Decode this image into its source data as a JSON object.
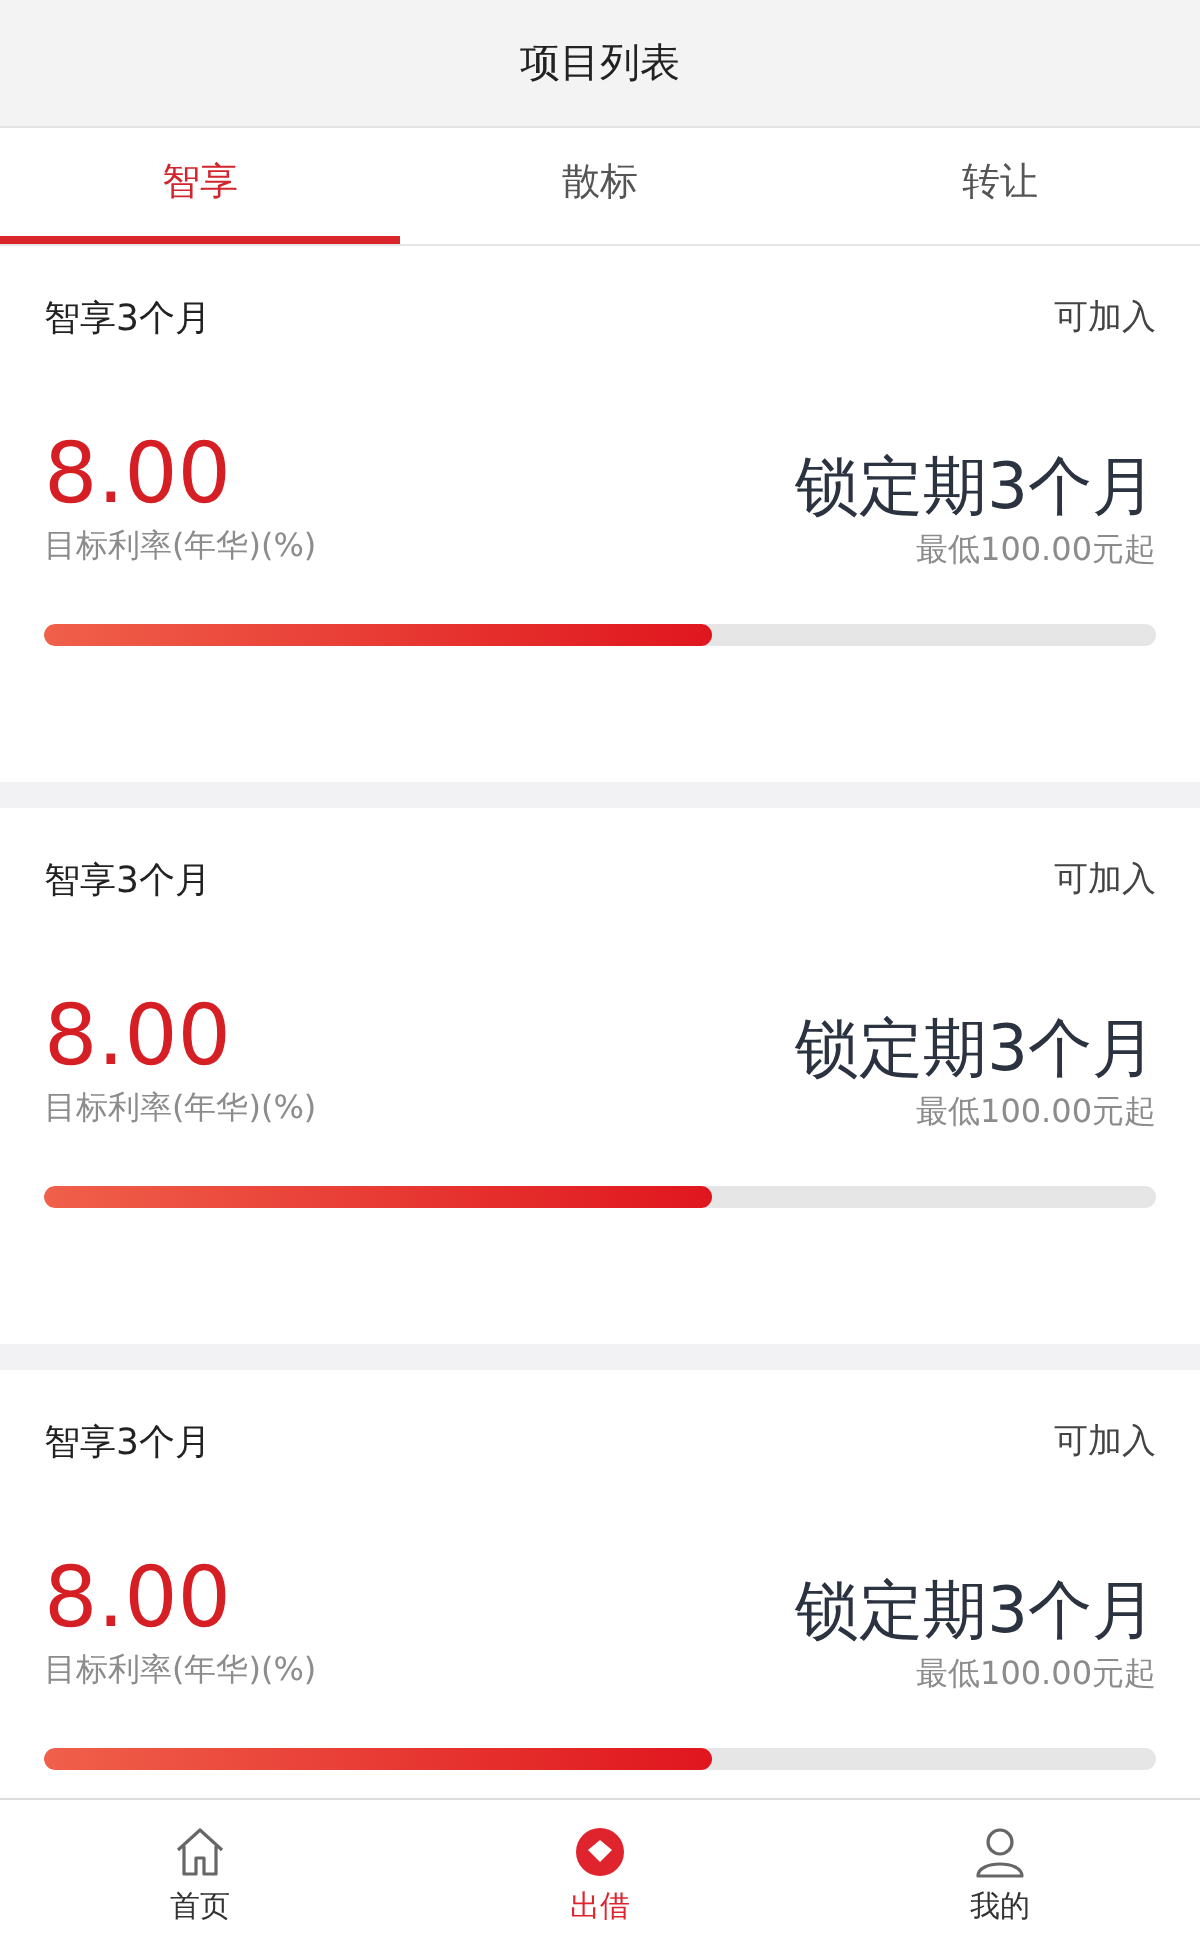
{
  "header": {
    "title": "项目列表"
  },
  "tabs": [
    {
      "label": "智享",
      "selected": true
    },
    {
      "label": "散标",
      "selected": false
    },
    {
      "label": "转让",
      "selected": false
    }
  ],
  "products": [
    {
      "name": "智享3个月",
      "status": "可加入",
      "rate": "8.00",
      "rate_label": "目标利率(年华)(%)",
      "term": "锁定期3个月",
      "minimum": "最低100.00元起",
      "level": 0.6
    },
    {
      "name": "智享3个月",
      "status": "可加入",
      "rate": "8.00",
      "rate_label": "目标利率(年华)(%)",
      "term": "锁定期3个月",
      "minimum": "最低100.00元起",
      "level": 0.6
    },
    {
      "name": "智享3个月",
      "status": "可加入",
      "rate": "8.00",
      "rate_label": "目标利率(年华)(%)",
      "term": "锁定期3个月",
      "minimum": "最低100.00元起",
      "level": 0.6
    }
  ],
  "nav": [
    {
      "label": "首页",
      "kind": "home",
      "selected": false
    },
    {
      "label": "出借",
      "kind": "lend",
      "selected": true
    },
    {
      "label": "我的",
      "kind": "profile",
      "selected": false
    }
  ]
}
